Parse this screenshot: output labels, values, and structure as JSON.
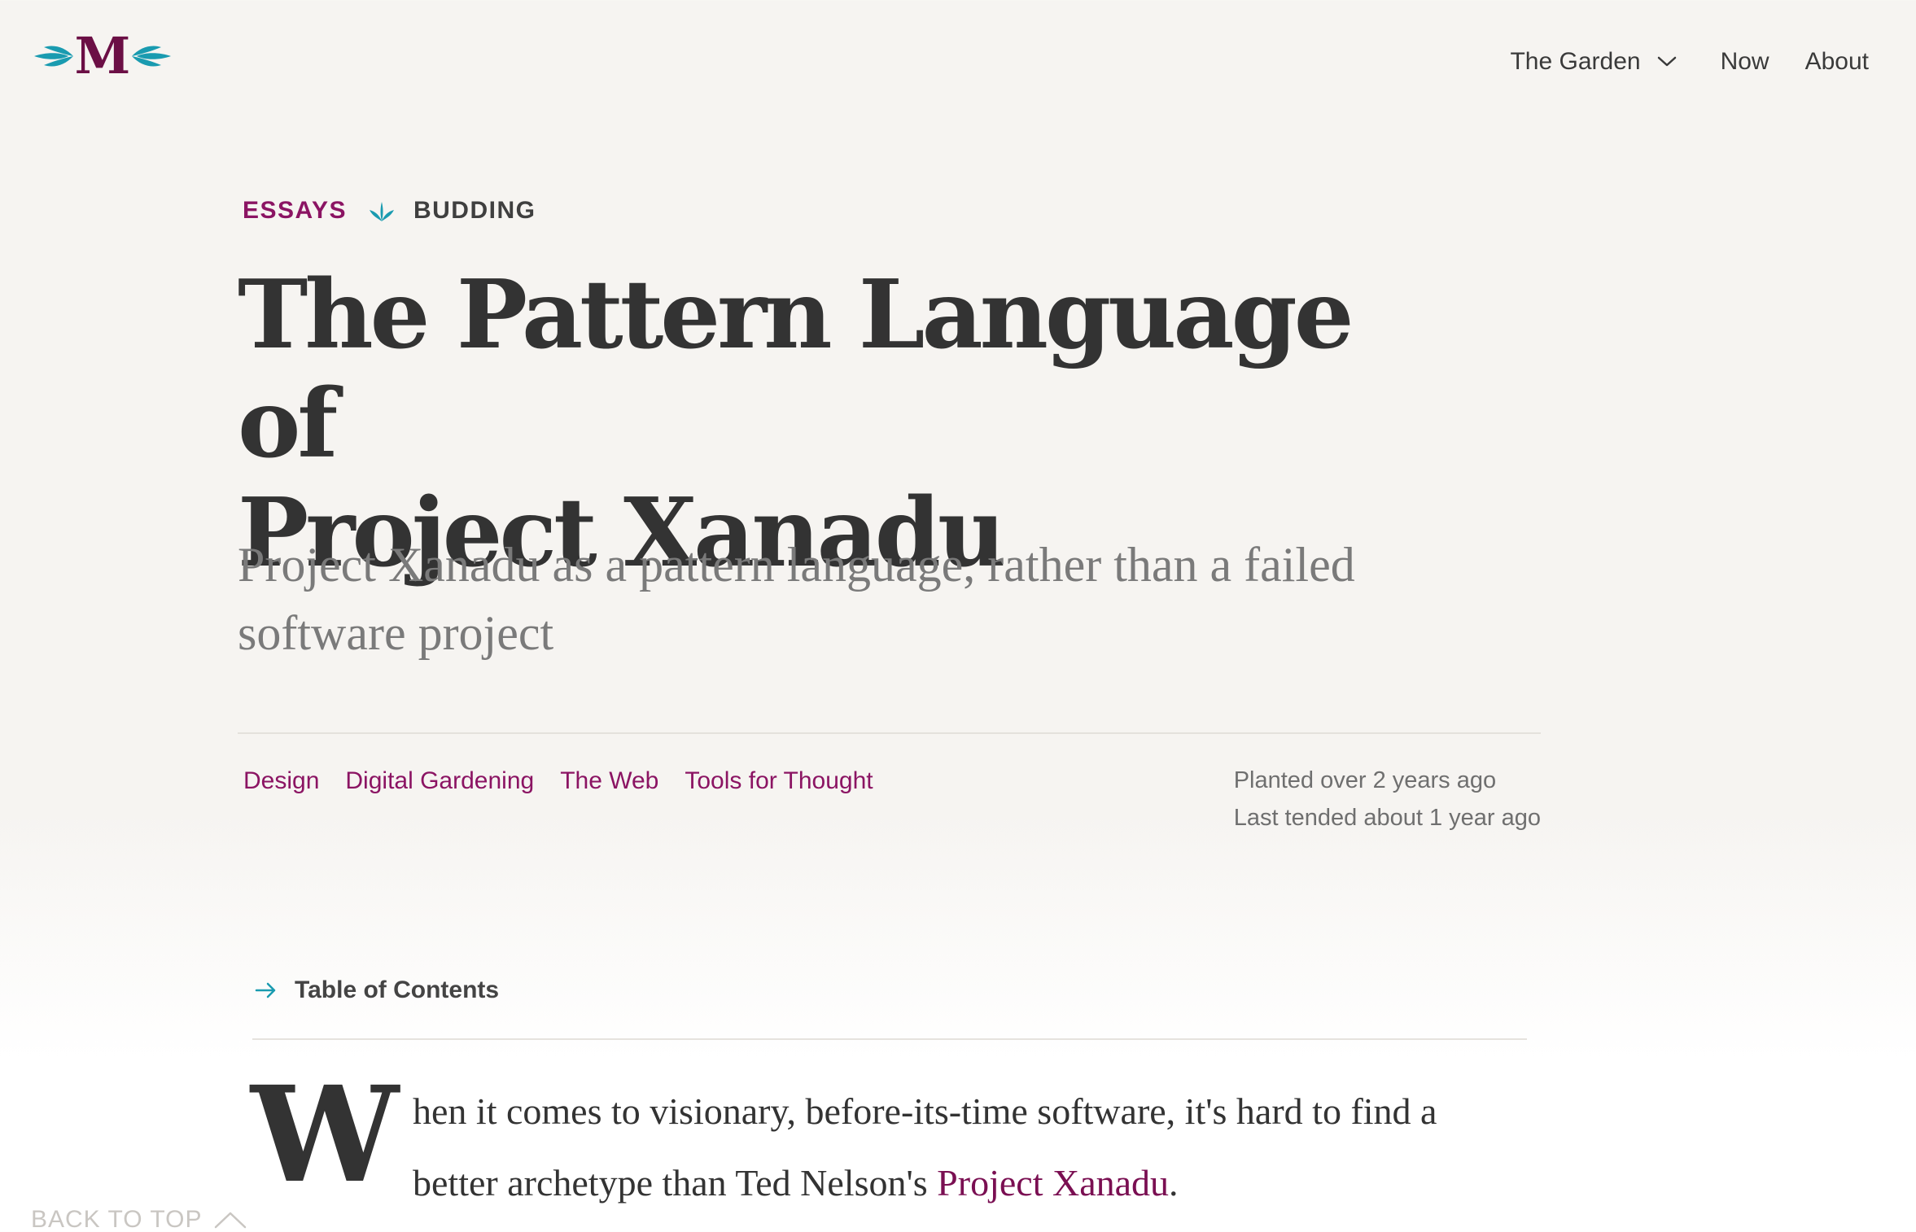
{
  "header": {
    "logo_letter": "M",
    "nav": [
      {
        "label": "The Garden",
        "has_dropdown": true
      },
      {
        "label": "Now"
      },
      {
        "label": "About"
      }
    ]
  },
  "article": {
    "category": "ESSAYS",
    "growth_stage": "BUDDING",
    "title_line1": "The Pattern Language of",
    "title_line2": "Project Xanadu",
    "subtitle_line1": "Project Xanadu as a pattern language, rather than a failed",
    "subtitle_line2": "software project",
    "tags": [
      "Design",
      "Digital Gardening",
      "The Web",
      "Tools for Thought"
    ],
    "planted": "Planted over 2 years ago",
    "last_tended": "Last tended about 1 year ago",
    "toc_label": "Table of Contents",
    "dropcap": "W",
    "body_line1": "hen it comes to visionary, before-its-time software, it's hard to find a",
    "body_line2_prefix": "better archetype than Ted Nelson's ",
    "body_link": "Project Xanadu",
    "body_line2_suffix": "."
  },
  "back_to_top": "BACK TO TOP",
  "colors": {
    "background": "#f6f4f1",
    "accent": "#8b1463",
    "teal": "#1a9bb0",
    "text": "#333333",
    "muted": "#7a7a7a"
  },
  "icons": [
    "leaf-logo-icon",
    "chevron-down-icon",
    "sprout-icon",
    "arrow-right-icon",
    "chevron-up-icon"
  ]
}
